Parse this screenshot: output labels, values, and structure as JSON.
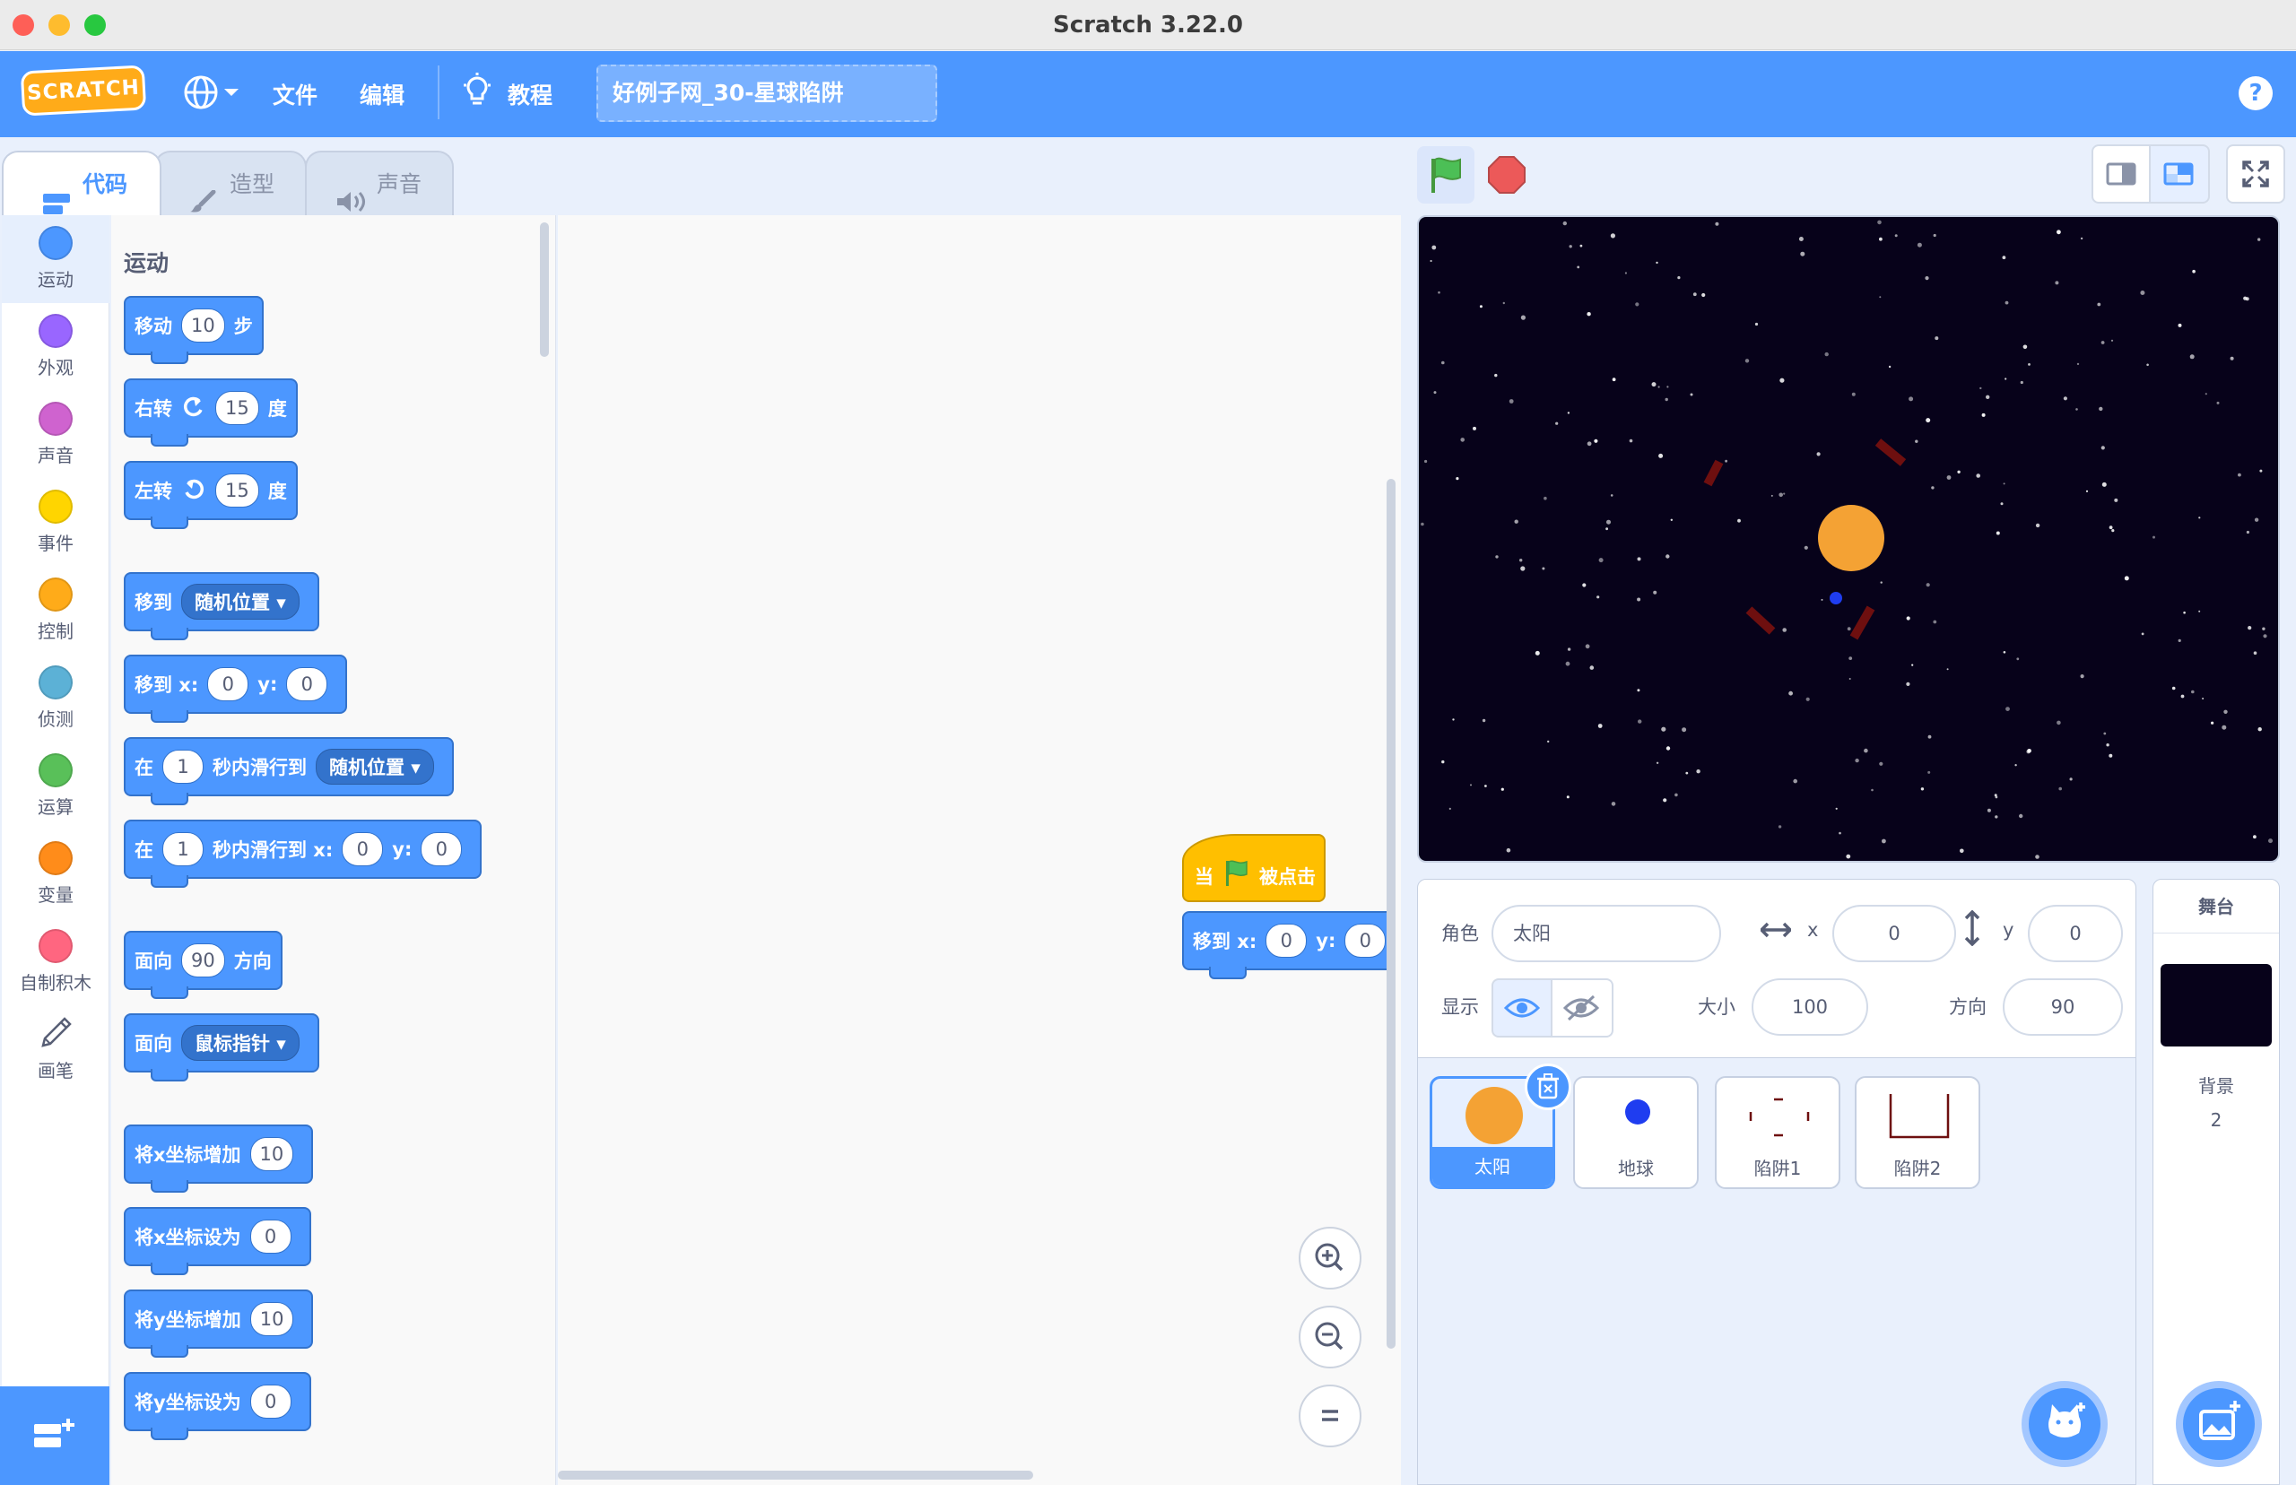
{
  "window": {
    "title": "Scratch 3.22.0"
  },
  "menu": {
    "file": "文件",
    "edit": "编辑",
    "tutorials": "教程",
    "project_title": "好例子网_30-星球陷阱",
    "logo_text": "SCRATCH"
  },
  "tabs": {
    "code": "代码",
    "costumes": "造型",
    "sounds": "声音"
  },
  "categories": [
    {
      "label": "运动",
      "color": "#4c97ff"
    },
    {
      "label": "外观",
      "color": "#9966ff"
    },
    {
      "label": "声音",
      "color": "#cf63cf"
    },
    {
      "label": "事件",
      "color": "#ffd500"
    },
    {
      "label": "控制",
      "color": "#ffab19"
    },
    {
      "label": "侦测",
      "color": "#5cb1d6"
    },
    {
      "label": "运算",
      "color": "#59c059"
    },
    {
      "label": "变量",
      "color": "#ff8c1a"
    },
    {
      "label": "自制积木",
      "color": "#ff6680"
    },
    {
      "label": "画笔",
      "color": "#0fbd8c"
    }
  ],
  "palette": {
    "heading": "运动",
    "b1": {
      "a": "移动",
      "v": "10",
      "b": "步"
    },
    "b2": {
      "a": "右转",
      "v": "15",
      "b": "度"
    },
    "b3": {
      "a": "左转",
      "v": "15",
      "b": "度"
    },
    "b4": {
      "a": "移到",
      "d": "随机位置"
    },
    "b5": {
      "a": "移到 x:",
      "x": "0",
      "y_label": "y:",
      "y": "0"
    },
    "b6": {
      "a": "在",
      "v": "1",
      "b": "秒内滑行到",
      "d": "随机位置"
    },
    "b7": {
      "a": "在",
      "v": "1",
      "b": "秒内滑行到 x:",
      "x": "0",
      "y_label": "y:",
      "y": "0"
    },
    "b8": {
      "a": "面向",
      "v": "90",
      "b": "方向"
    },
    "b9": {
      "a": "面向",
      "d": "鼠标指针"
    },
    "b10": {
      "a": "将x坐标增加",
      "v": "10"
    },
    "b11": {
      "a": "将x坐标设为",
      "v": "0"
    },
    "b12": {
      "a": "将y坐标增加",
      "v": "10"
    },
    "b13": {
      "a": "将y坐标设为",
      "v": "0"
    }
  },
  "script": {
    "hat_when": "当",
    "hat_clicked": "被点击",
    "goto_label": "移到 x:",
    "x": "0",
    "y_label": "y:",
    "y": "0"
  },
  "sprite_info": {
    "sprite_label": "角色",
    "sprite_name": "太阳",
    "x_label": "x",
    "x": "0",
    "y_label": "y",
    "y": "0",
    "show_label": "显示",
    "size_label": "大小",
    "size": "100",
    "direction_label": "方向",
    "direction": "90"
  },
  "sprites": [
    {
      "name": "太阳",
      "selected": true
    },
    {
      "name": "地球",
      "selected": false
    },
    {
      "name": "陷阱1",
      "selected": false
    },
    {
      "name": "陷阱2",
      "selected": false
    }
  ],
  "stage_panel": {
    "title": "舞台",
    "backdrops_label": "背景",
    "backdrops_count": "2"
  },
  "colors": {
    "motion": "#4c97ff",
    "events": "#ffbf00",
    "menu": "#4c97ff",
    "stage_bg": "#07021a",
    "sun": "#f4a234",
    "earth": "#1f3df0",
    "trap": "#6e0f0f"
  }
}
